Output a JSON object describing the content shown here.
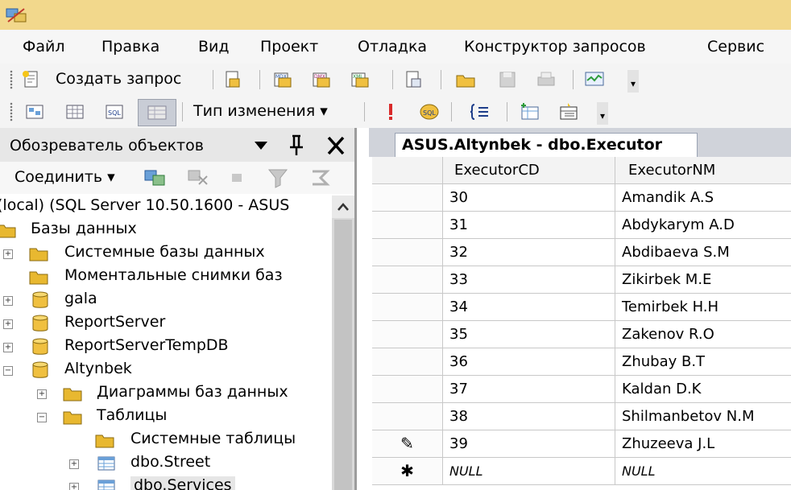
{
  "app": {
    "icon": "app-logo-icon"
  },
  "menubar": {
    "items": [
      "Файл",
      "Правка",
      "Вид",
      "Проект",
      "Отладка",
      "Конструктор запросов",
      "Сервис"
    ]
  },
  "toolbar1": {
    "new_query_label": "Создать запрос"
  },
  "toolbar2": {
    "change_type_label": "Тип изменения ▾"
  },
  "object_explorer": {
    "title": "Обозреватель объектов",
    "connect_label": "Соединить ▾",
    "tree": [
      {
        "label": "(local) (SQL Server 10.50.1600 - ASUS",
        "expander": "",
        "icon": "server-icon"
      },
      {
        "label": "Базы данных",
        "expander": "",
        "icon": "folder-icon"
      },
      {
        "label": "Системные базы данных",
        "expander": "+",
        "icon": "folder-icon"
      },
      {
        "label": "Моментальные снимки баз",
        "expander": "",
        "icon": "folder-icon"
      },
      {
        "label": "gala",
        "expander": "+",
        "icon": "database-icon"
      },
      {
        "label": "ReportServer",
        "expander": "+",
        "icon": "database-icon"
      },
      {
        "label": "ReportServerTempDB",
        "expander": "+",
        "icon": "database-icon"
      },
      {
        "label": "Altynbek",
        "expander": "−",
        "icon": "database-icon"
      },
      {
        "label": "Диаграммы баз данных",
        "expander": "+",
        "icon": "folder-icon"
      },
      {
        "label": "Таблицы",
        "expander": "−",
        "icon": "folder-icon"
      },
      {
        "label": "Системные таблицы",
        "expander": "",
        "icon": "folder-icon"
      },
      {
        "label": "dbo.Street",
        "expander": "+",
        "icon": "table-icon"
      },
      {
        "label": "dbo.Services",
        "expander": "+",
        "icon": "table-icon"
      }
    ]
  },
  "editor": {
    "tab_label": "ASUS.Altynbek - dbo.Executor",
    "columns": [
      "ExecutorCD",
      "ExecutorNM"
    ],
    "rows": [
      {
        "marker": "",
        "cd": "30",
        "nm": "Amandik A.S"
      },
      {
        "marker": "",
        "cd": "31",
        "nm": "Abdykarym A.D"
      },
      {
        "marker": "",
        "cd": "32",
        "nm": "Abdibaeva S.M"
      },
      {
        "marker": "",
        "cd": "33",
        "nm": "Zikirbek M.E"
      },
      {
        "marker": "",
        "cd": "34",
        "nm": "Temirbek H.H"
      },
      {
        "marker": "",
        "cd": "35",
        "nm": "Zakenov R.O"
      },
      {
        "marker": "",
        "cd": "36",
        "nm": "Zhubay B.T"
      },
      {
        "marker": "",
        "cd": "37",
        "nm": "Kaldan D.K"
      },
      {
        "marker": "",
        "cd": "38",
        "nm": "Shilmanbetov N.M"
      },
      {
        "marker": "✎",
        "cd": "39",
        "nm": "Zhuzeeva J.L"
      },
      {
        "marker": "✱",
        "cd": "NULL",
        "nm": "NULL"
      }
    ]
  }
}
